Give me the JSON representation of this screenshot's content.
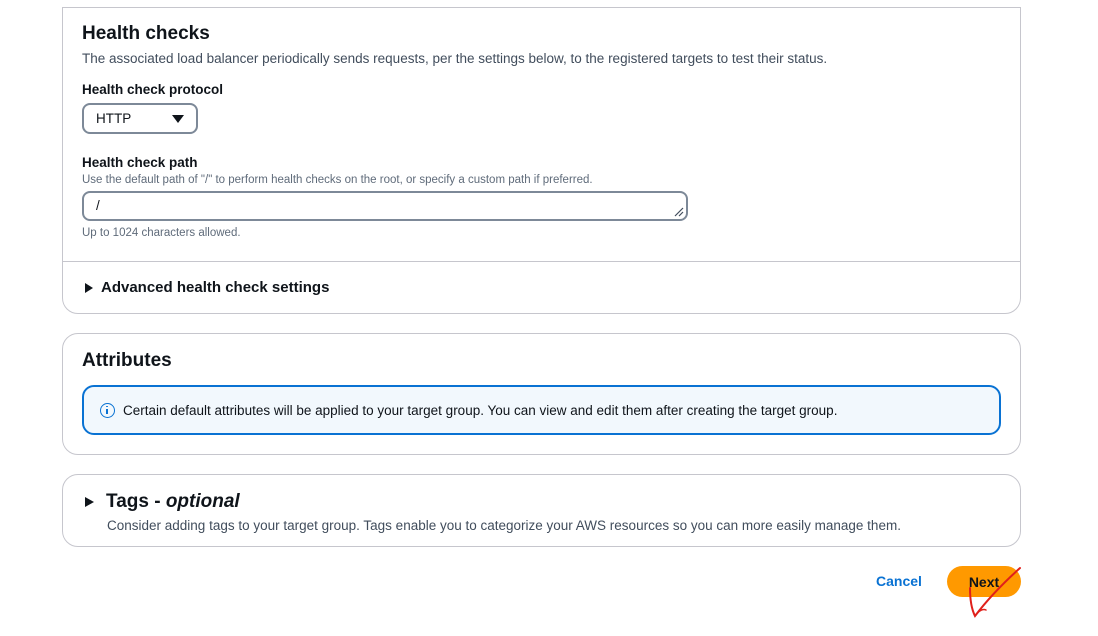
{
  "health": {
    "title": "Health checks",
    "description": "The associated load balancer periodically sends requests, per the settings below, to the registered targets to test their status.",
    "protocol_label": "Health check protocol",
    "protocol_value": "HTTP",
    "path_label": "Health check path",
    "path_hint": "Use the default path of \"/\" to perform health checks on the root, or specify a custom path if preferred.",
    "path_value": "/",
    "path_constraint": "Up to 1024 characters allowed.",
    "advanced_label": "Advanced health check settings"
  },
  "attributes": {
    "title": "Attributes",
    "info": "Certain default attributes will be applied to your target group. You can view and edit them after creating the target group."
  },
  "tags": {
    "title": "Tags -",
    "title_optional": "optional",
    "description": "Consider adding tags to your target group. Tags enable you to categorize your AWS resources so you can more easily manage them."
  },
  "actions": {
    "cancel_label": "Cancel",
    "next_label": "Next"
  },
  "colors": {
    "primary_button": "#ff9900",
    "link": "#0972d3",
    "info_border": "#0972d3",
    "annotation": "#e0201b"
  }
}
